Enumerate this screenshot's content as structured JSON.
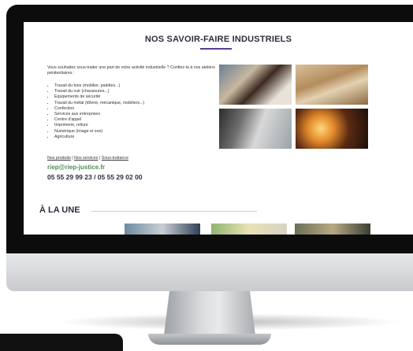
{
  "page": {
    "title": "NOS SAVOIR-FAIRE INDUSTRIELS",
    "intro": "Vous souhaitez sous-traiter une part de votre activité industrielle ? Confiez-la à nos ateliers pénitentiaires :",
    "services": [
      "Travail du bois (mobilier, palettes...)",
      "Travail du cuir (chaussures...)",
      "Equipements de sécurité",
      "Travail du métal (tôlerie, mécanique, mobiliers...)",
      "Confection",
      "Services aux entreprises",
      "Centre d'appel",
      "Imprimerie, reliure",
      "Numérique (image et son)",
      "Agriculture"
    ],
    "links": {
      "produits": "Nos produits",
      "services": "Nos services",
      "soustraitance": "Sous-traitance",
      "separator": "|"
    },
    "email": "riep@riep-justice.fr",
    "phone": "05 55 29 99 23 / 05 55 29 02 00",
    "section_title": "À LA UNE"
  },
  "colors": {
    "accent": "#5a3d8c",
    "email": "#4e8f5a",
    "heading": "#2d2f3b"
  }
}
